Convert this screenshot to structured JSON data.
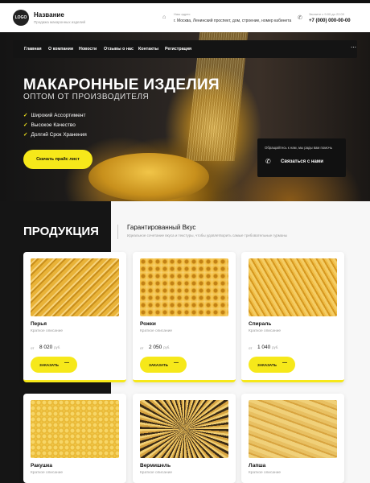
{
  "header": {
    "logo": "LOGO",
    "brand": "Название",
    "brand_sub": "Продажа макаронных изделий",
    "address_label": "Наш адрес",
    "address": "г. Москва, Ленинский проспект, дом, строение, номер кабинета",
    "phone_label": "Звоните с 9:00 до 22:00",
    "phone": "+7 (000) 000-00-00"
  },
  "nav": {
    "items": [
      "Главная",
      "О компании",
      "Новости",
      "Отзывы о нас",
      "Контакты",
      "Регистрация"
    ],
    "more_icon": "ellipsis-icon"
  },
  "hero": {
    "title": "МАКАРОННЫЕ ИЗДЕЛИЯ",
    "subtitle": "ОПТОМ ОТ ПРОИЗВОДИТЕЛЯ",
    "benefits": [
      "Широкий Ассортимент",
      "Высокое Качество",
      "Долгий Срок Хранения"
    ],
    "cta": "Скачать прайс лист",
    "contact_hint": "Обращайтесь к нам, мы рады вам помочь",
    "contact_button": "Связаться с нами"
  },
  "products_section": {
    "title": "ПРОДУКЦИЯ",
    "subtitle": "Гарантированный Вкус",
    "note": "Идеальное сочетание вкуса и текстуры, чтобы удовлетворить самые требовательные гурманы"
  },
  "products": [
    {
      "name": "Перья",
      "desc": "Краткое описание",
      "price_prefix": "от",
      "price": "8 020",
      "currency": "руб.",
      "button": "ЗАКАЗАТЬ"
    },
    {
      "name": "Рожки",
      "desc": "Краткое описание",
      "price_prefix": "от",
      "price": "2 050",
      "currency": "руб.",
      "button": "ЗАКАЗАТЬ"
    },
    {
      "name": "Спираль",
      "desc": "Краткое описание",
      "price_prefix": "от",
      "price": "1 040",
      "currency": "руб.",
      "button": "ЗАКАЗАТЬ"
    },
    {
      "name": "Ракушка",
      "desc": "Краткое описание"
    },
    {
      "name": "Вермишель",
      "desc": "Краткое описание"
    },
    {
      "name": "Лапша",
      "desc": "Краткое описание"
    }
  ],
  "colors": {
    "accent": "#f6e81a",
    "dark": "#151515"
  }
}
